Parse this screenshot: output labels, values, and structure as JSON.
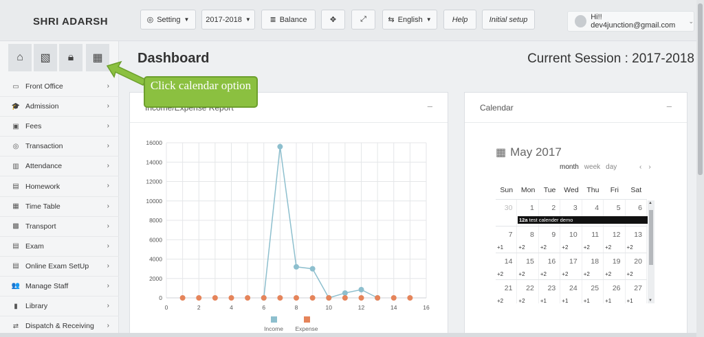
{
  "app": {
    "brand": "SHRI ADARSH"
  },
  "toolbar": {
    "setting": "Setting",
    "session": "2017-2018",
    "balance": "Balance",
    "language": "English",
    "help": "Help",
    "initial_setup": "Initial setup"
  },
  "user": {
    "greeting": "Hi!! dev4junction@gmail.com"
  },
  "quick_icons": [
    "home-icon",
    "map-icon",
    "lock-icon",
    "calendar-icon"
  ],
  "sidebar": {
    "items": [
      {
        "label": "Front Office",
        "icon": "monitor-icon",
        "glyph": "▭"
      },
      {
        "label": "Admission",
        "icon": "graduation-cap-icon",
        "glyph": "🎓"
      },
      {
        "label": "Fees",
        "icon": "money-icon",
        "glyph": "▣"
      },
      {
        "label": "Transaction",
        "icon": "globe-icon",
        "glyph": "◎"
      },
      {
        "label": "Attendance",
        "icon": "bar-chart-icon",
        "glyph": "▥"
      },
      {
        "label": "Homework",
        "icon": "file-icon",
        "glyph": "▤"
      },
      {
        "label": "Time Table",
        "icon": "calendar-icon",
        "glyph": "▦"
      },
      {
        "label": "Transport",
        "icon": "bus-icon",
        "glyph": "▩"
      },
      {
        "label": "Exam",
        "icon": "file-text-icon",
        "glyph": "▤"
      },
      {
        "label": "Online Exam SetUp",
        "icon": "file-text-icon",
        "glyph": "▤"
      },
      {
        "label": "Manage Staff",
        "icon": "users-icon",
        "glyph": "👥"
      },
      {
        "label": "Library",
        "icon": "book-icon",
        "glyph": "▮"
      },
      {
        "label": "Dispatch & Receiving",
        "icon": "exchange-icon",
        "glyph": "⇄"
      }
    ]
  },
  "main": {
    "title": "Dashboard",
    "session_label": "Current Session : 2017-2018"
  },
  "income_panel": {
    "title": "Income/Expense Report"
  },
  "calendar_panel": {
    "title": "Calendar",
    "month_label": "May 2017",
    "views": [
      "month",
      "week",
      "day"
    ],
    "weekdays": [
      "Sun",
      "Mon",
      "Tue",
      "Wed",
      "Thu",
      "Fri",
      "Sat"
    ],
    "weeks": [
      [
        {
          "d": "30",
          "o": true,
          "m": ""
        },
        {
          "d": "1",
          "m": ""
        },
        {
          "d": "2",
          "m": ""
        },
        {
          "d": "3",
          "m": ""
        },
        {
          "d": "4",
          "m": ""
        },
        {
          "d": "5",
          "m": ""
        },
        {
          "d": "6",
          "m": ""
        }
      ],
      [
        {
          "d": "7",
          "m": "+1"
        },
        {
          "d": "8",
          "m": "+2"
        },
        {
          "d": "9",
          "m": "+2"
        },
        {
          "d": "10",
          "m": "+2"
        },
        {
          "d": "11",
          "m": "+2"
        },
        {
          "d": "12",
          "m": "+2"
        },
        {
          "d": "13",
          "m": "+2"
        }
      ],
      [
        {
          "d": "14",
          "m": "+2"
        },
        {
          "d": "15",
          "m": "+2"
        },
        {
          "d": "16",
          "m": "+2"
        },
        {
          "d": "17",
          "m": "+2"
        },
        {
          "d": "18",
          "m": "+2"
        },
        {
          "d": "19",
          "m": "+2"
        },
        {
          "d": "20",
          "m": "+2"
        }
      ],
      [
        {
          "d": "21",
          "m": "+2"
        },
        {
          "d": "22",
          "m": "+2"
        },
        {
          "d": "23",
          "m": "+1"
        },
        {
          "d": "24",
          "m": "+1"
        },
        {
          "d": "25",
          "m": "+1"
        },
        {
          "d": "26",
          "m": "+1"
        },
        {
          "d": "27",
          "m": "+1"
        }
      ]
    ],
    "event": {
      "time": "12a",
      "title": "test calender demo"
    }
  },
  "callout": {
    "text": "Click calendar option"
  },
  "colors": {
    "income": "#8dbfce",
    "expense": "#e5845a",
    "callout": "#8bc040"
  },
  "chart_data": {
    "type": "line",
    "title": "",
    "xlabel": "",
    "ylabel": "",
    "xlim": [
      0,
      16
    ],
    "ylim": [
      0,
      16000
    ],
    "xticks": [
      0,
      2,
      4,
      6,
      8,
      10,
      12,
      14,
      16
    ],
    "yticks": [
      0,
      2000,
      4000,
      6000,
      8000,
      10000,
      12000,
      14000,
      16000
    ],
    "grid": true,
    "legend": "bottom",
    "series": [
      {
        "name": "Income",
        "x": [
          6,
          7,
          8,
          9,
          10,
          11,
          12,
          13
        ],
        "values": [
          0,
          15600,
          3200,
          3000,
          0,
          500,
          850,
          0
        ]
      },
      {
        "name": "Expense",
        "x": [
          1,
          2,
          3,
          4,
          5,
          6,
          7,
          8,
          9,
          10,
          11,
          12,
          13,
          14,
          15
        ],
        "values": [
          0,
          0,
          0,
          0,
          0,
          0,
          0,
          0,
          0,
          0,
          0,
          0,
          0,
          0,
          0
        ]
      }
    ]
  }
}
